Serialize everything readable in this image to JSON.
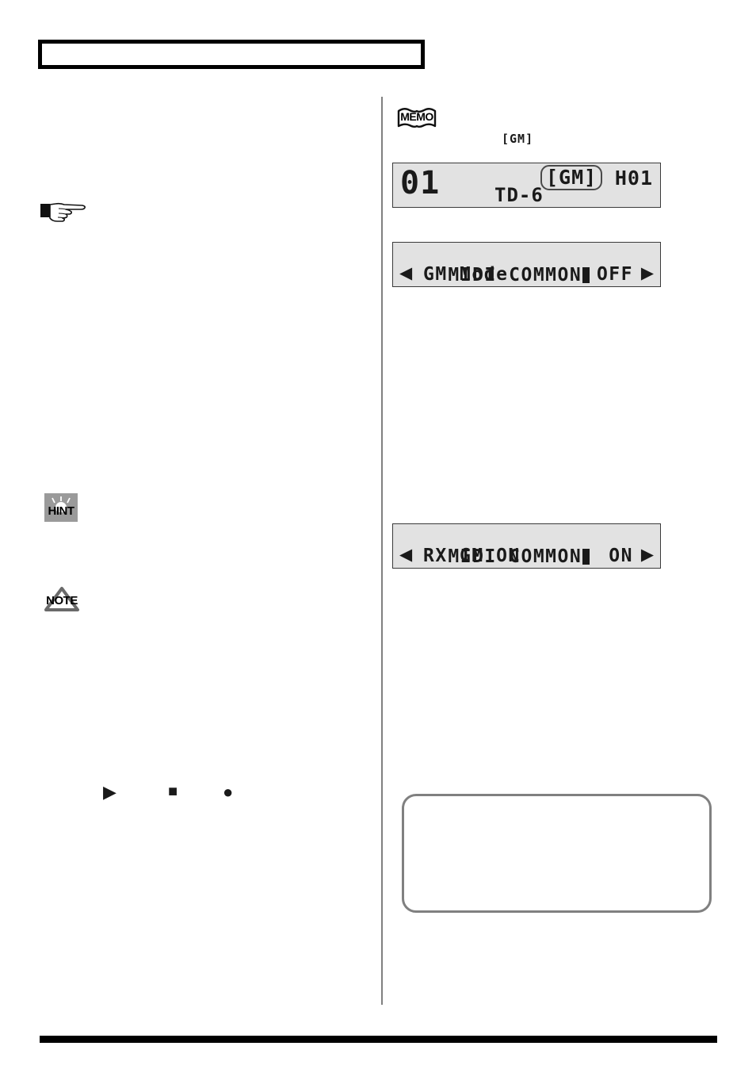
{
  "page": {
    "header_title": "",
    "bottom_rule_visible": true,
    "divider_visible": true
  },
  "markers": {
    "memo_label": "MEMO",
    "hint_label": "HINT",
    "note_label": "NOTE",
    "hand_label": "pointing-hand"
  },
  "left_column": {
    "paragraphs": [
      {
        "id": "p1",
        "text": ""
      },
      {
        "id": "p2",
        "text": ""
      },
      {
        "id": "p3",
        "text": ""
      },
      {
        "id": "p4",
        "text": ""
      },
      {
        "id": "p5",
        "text": ""
      },
      {
        "id": "p6",
        "text": ""
      }
    ],
    "transport": {
      "play_symbol": "▶",
      "stop_symbol": "■",
      "record_symbol": "●"
    }
  },
  "right_column": {
    "paragraphs": [
      {
        "id": "r1",
        "text": ""
      },
      {
        "id": "r2",
        "text": ""
      },
      {
        "id": "r3",
        "text": ""
      },
      {
        "id": "r4",
        "text": ""
      }
    ],
    "lcd_caption": "[GM]",
    "callout_text": ""
  },
  "lcd_screens": [
    {
      "id": "kit-screen",
      "kit_number": "01",
      "kit_name": "TD-6",
      "gm_tag": "[GM]",
      "gm_tag_highlighted": true,
      "right_value": "H01"
    },
    {
      "id": "gm-mode-screen",
      "title": "MIDI COMMON",
      "title_cursor": true,
      "param": "GM Mode",
      "value": "OFF",
      "arrow_left": "◀",
      "arrow_right": "▶"
    },
    {
      "id": "rx-gm-on-screen",
      "title": "MIDI COMMON",
      "title_cursor": true,
      "param": "RX GM ON",
      "value": "ON",
      "arrow_left": "◀",
      "arrow_right": "▶"
    }
  ],
  "colors": {
    "lcd_background": "#e2e2e2",
    "lcd_border": "#3a3a3a",
    "lcd_text": "#1a1a1a",
    "divider": "#808080",
    "callout_border": "#808080",
    "rule": "#000000",
    "hint_badge_bg": "#9a9a9a"
  }
}
